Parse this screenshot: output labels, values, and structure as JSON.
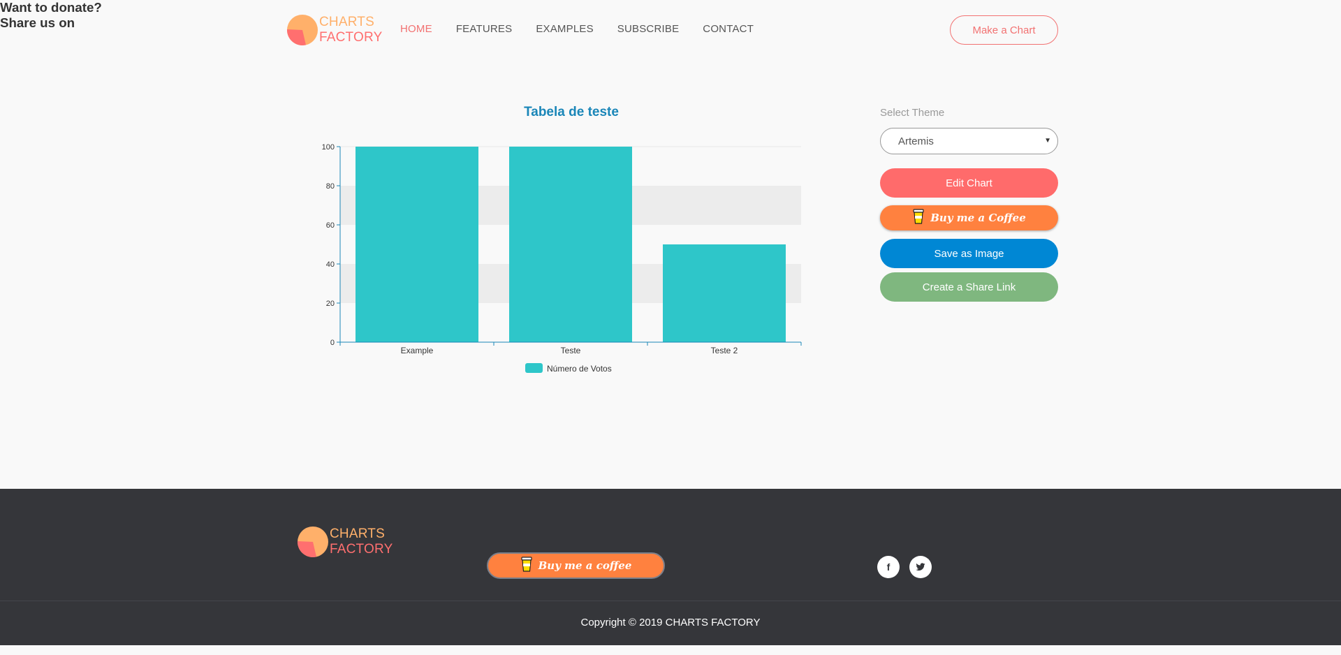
{
  "brand": {
    "line1": "CHARTS",
    "line2": "FACTORY"
  },
  "nav": {
    "items": [
      {
        "label": "HOME",
        "active": true
      },
      {
        "label": "FEATURES",
        "active": false
      },
      {
        "label": "EXAMPLES",
        "active": false
      },
      {
        "label": "SUBSCRIBE",
        "active": false
      },
      {
        "label": "CONTACT",
        "active": false
      }
    ],
    "cta_label": "Make a Chart"
  },
  "chart_data": {
    "type": "bar",
    "title": "Tabela de teste",
    "categories": [
      "Example",
      "Teste",
      "Teste 2"
    ],
    "series": [
      {
        "name": "Número de Votos",
        "values": [
          100,
          100,
          50
        ],
        "color": "#2ec6c9"
      }
    ],
    "ylim": [
      0,
      100
    ],
    "yticks": [
      0,
      20,
      40,
      60,
      80,
      100
    ],
    "xlabel": "",
    "ylabel": "",
    "legend": "bottom-center",
    "grid": "alternating horizontal bands"
  },
  "side_panel": {
    "theme_label": "Select Theme",
    "theme_value": "Artemis",
    "edit_label": "Edit Chart",
    "coffee_label": "Buy me a Coffee",
    "save_label": "Save as Image",
    "share_label": "Create a Share Link"
  },
  "footer": {
    "donate_title": "Want to donate?",
    "coffee_label": "Buy me a coffee",
    "share_title": "Share us on",
    "social": [
      {
        "icon": "facebook-icon",
        "glyph": "f"
      },
      {
        "icon": "twitter-icon",
        "glyph": "t"
      }
    ],
    "copyright": "Copyright © 2019 CHARTS FACTORY"
  },
  "colors": {
    "accent": "#f27272",
    "edit": "#ff6b6b",
    "coffee": "#ff813f",
    "save": "#0087d4",
    "share": "#7fb77f",
    "footer_bg": "#35363a",
    "title_blue": "#1a86b8"
  }
}
